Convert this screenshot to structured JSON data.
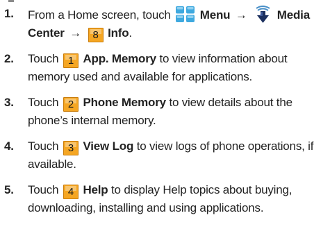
{
  "steps": [
    {
      "number": "1.",
      "text_1": "From a Home screen, touch",
      "menu_label": "Menu",
      "arrow_1": "→",
      "media_label": "Media",
      "center_label": "Center",
      "arrow_2": "→",
      "key": "8",
      "key_label": "Info",
      "trailing": "."
    },
    {
      "number": "2.",
      "text_1": "Touch",
      "key": "1",
      "key_label": "App. Memory",
      "text_2": "to view information about memory used and available for applications."
    },
    {
      "number": "3.",
      "text_1": "Touch",
      "key": "2",
      "key_label": "Phone Memory",
      "text_2": "to view details about the phone’s internal memory."
    },
    {
      "number": "4.",
      "text_1": "Touch",
      "key": "3",
      "key_label": "View Log",
      "text_2": "to view logs of phone operations, if available."
    },
    {
      "number": "5.",
      "text_1": "Touch",
      "key": "4",
      "key_label": "Help",
      "text_2": "to display Help topics about buying, downloading, installing and using applications."
    }
  ],
  "icons": {
    "menu": "menu-grid-icon",
    "media_center": "media-center-download-icon",
    "key_color": "#f5a623",
    "menu_color": "#3fa9df"
  }
}
